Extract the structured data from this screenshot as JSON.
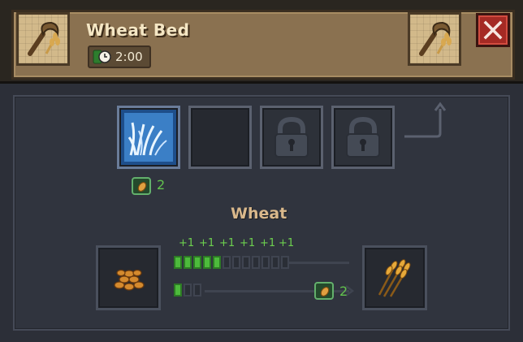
{
  "header": {
    "title": "Wheat Bed",
    "timer": "2:00",
    "close_icon": "close-x-icon",
    "left_icon": "sickle-wheat-icon",
    "right_icon": "sickle-wheat-icon"
  },
  "slots": [
    {
      "state": "filled",
      "icon": "frost-grass-icon"
    },
    {
      "state": "empty"
    },
    {
      "state": "locked",
      "icon": "lock-icon"
    },
    {
      "state": "locked",
      "icon": "lock-icon"
    }
  ],
  "seed_cost": {
    "icon": "seed-icon",
    "count": "2"
  },
  "product": {
    "name": "Wheat",
    "increments": [
      "+1",
      "+1",
      "+1",
      "+1",
      "+1",
      "+1"
    ],
    "progress_top": {
      "filled": 5,
      "total": 12
    },
    "progress_bottom": {
      "filled": 1,
      "total": 3
    },
    "output": {
      "icon": "seed-icon",
      "count": "2"
    },
    "input_icon": "grain-pile-icon",
    "result_icon": "wheat-bundle-icon"
  },
  "colors": {
    "header_bg": "#8a7150",
    "title": "#f4e6c4",
    "accent_green": "#62c24e",
    "close_bg": "#a52a24",
    "product_name": "#d9b88b"
  }
}
